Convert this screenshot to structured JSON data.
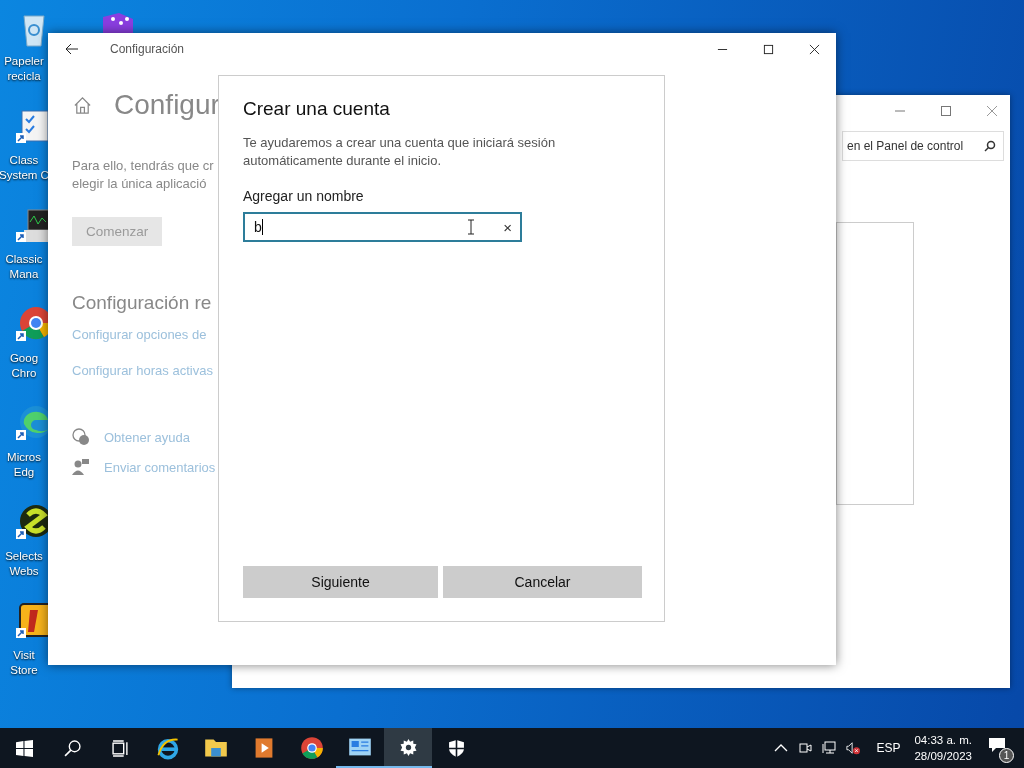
{
  "desktop_icons": [
    {
      "kind": "recycle",
      "lines": [
        "Papeler",
        "recicla"
      ]
    },
    {
      "kind": "system",
      "lines": [
        "Class",
        "System C"
      ]
    },
    {
      "kind": "monitor",
      "lines": [
        "Classic",
        "Mana"
      ]
    },
    {
      "kind": "chrome",
      "lines": [
        "Goog",
        "Chro"
      ]
    },
    {
      "kind": "edge",
      "lines": [
        "Micros",
        "Edg"
      ]
    },
    {
      "kind": "selects",
      "lines": [
        "Selects",
        "Webs"
      ]
    },
    {
      "kind": "store",
      "lines": [
        "Visit",
        "Store"
      ]
    }
  ],
  "control_panel": {
    "search": {
      "placeholder": "en el Panel de control"
    }
  },
  "settings": {
    "title": "Configuración",
    "heading": "Configur",
    "paragraph": [
      "Para ello, tendrás que cr",
      "elegir la única aplicació"
    ],
    "start_button": {
      "label": "Comenzar",
      "disabled": true
    },
    "related_heading": "Configuración re",
    "links": [
      "Configurar opciones de",
      "Configurar horas activas"
    ],
    "help": [
      {
        "kind": "help",
        "label": "Obtener ayuda"
      },
      {
        "kind": "feedback",
        "label": "Enviar comentarios"
      }
    ]
  },
  "dialog": {
    "title": "Crear una cuenta",
    "description": "Te ayudaremos a crear una cuenta que iniciará sesión automáticamente durante el inicio.",
    "name_label": "Agregar un nombre",
    "name_field": {
      "value": "b",
      "clear": "×"
    },
    "buttons": [
      "Siguiente",
      "Cancelar"
    ]
  },
  "taskbar": {
    "apps": [
      {
        "kind": "start",
        "running": false,
        "selected": false
      },
      {
        "kind": "search",
        "running": false,
        "selected": false
      },
      {
        "kind": "taskview",
        "running": false,
        "selected": false
      },
      {
        "kind": "ie",
        "running": false,
        "selected": false
      },
      {
        "kind": "explorer",
        "running": false,
        "selected": false
      },
      {
        "kind": "media",
        "running": false,
        "selected": false
      },
      {
        "kind": "chrome",
        "running": false,
        "selected": false
      },
      {
        "kind": "controlpanel",
        "running": true,
        "selected": false
      },
      {
        "kind": "settings",
        "running": true,
        "selected": true
      },
      {
        "kind": "security",
        "running": false,
        "selected": false
      }
    ],
    "language": "ESP",
    "time": "04:33 a. m.",
    "date": "28/09/2023",
    "notifications": "1"
  }
}
